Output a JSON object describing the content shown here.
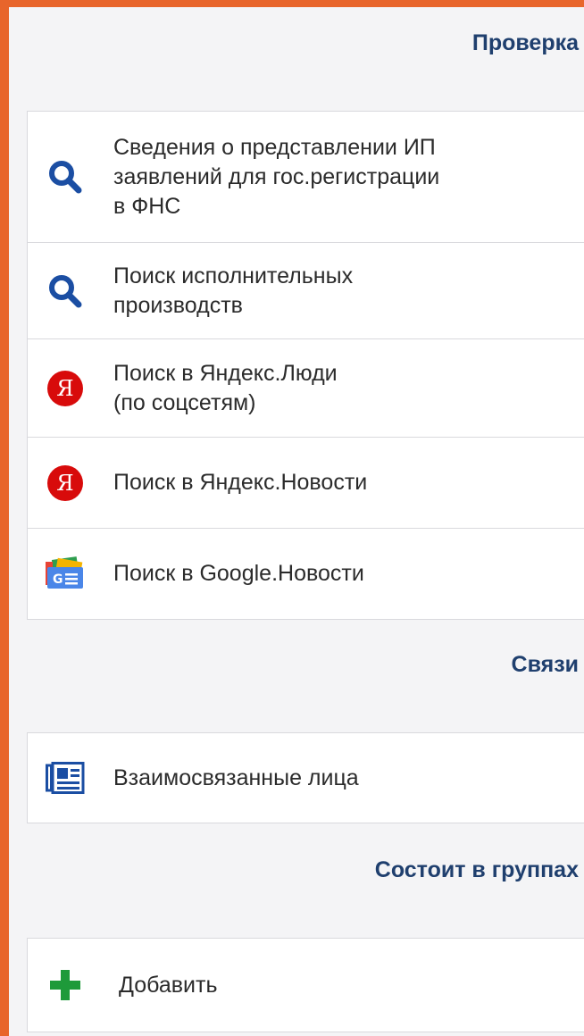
{
  "sections": {
    "check": {
      "title": "Проверка",
      "items": [
        {
          "label": "Сведения о представлении ИП\nзаявлений для гос.регистрации\nв ФНС",
          "icon": "search-icon"
        },
        {
          "label": "Поиск исполнительных\nпроизводств",
          "icon": "search-icon"
        },
        {
          "label": "Поиск в Яндекс.Люди\n(по соцсетям)",
          "icon": "yandex-icon",
          "icon_glyph": "Я"
        },
        {
          "label": "Поиск в Яндекс.Новости",
          "icon": "yandex-icon",
          "icon_glyph": "Я"
        },
        {
          "label": "Поиск в Google.Новости",
          "icon": "google-news-icon"
        }
      ]
    },
    "links": {
      "title": "Связи",
      "items": [
        {
          "label": "Взаимосвязанные лица",
          "icon": "related-persons-icon"
        }
      ]
    },
    "groups": {
      "title": "Состоит в группах",
      "items": [
        {
          "label": "Добавить",
          "icon": "plus-icon"
        }
      ]
    }
  },
  "colors": {
    "accent_border": "#e8652b",
    "header_text": "#1f3f6e",
    "search_icon": "#1b4ea3",
    "yandex_red": "#d80b0b",
    "plus_green": "#1e9a3a"
  }
}
